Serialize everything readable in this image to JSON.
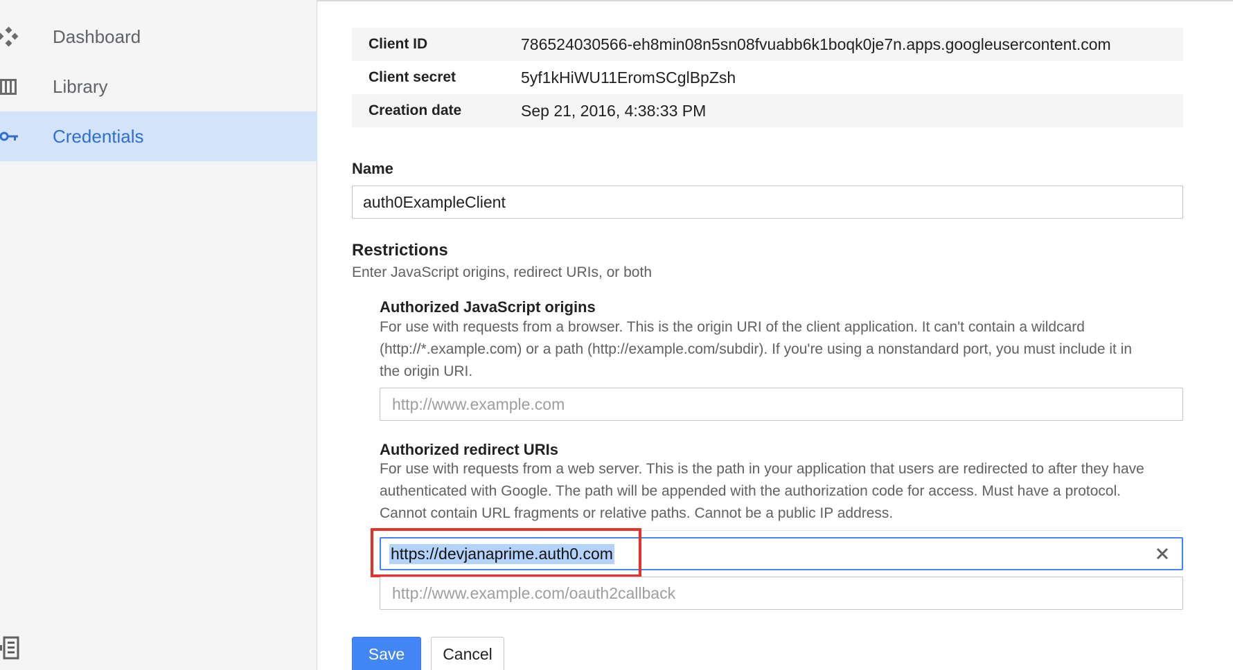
{
  "sidebar": {
    "items": [
      {
        "label": "Dashboard",
        "icon": "dashboard-icon",
        "active": false
      },
      {
        "label": "Library",
        "icon": "library-icon",
        "active": false
      },
      {
        "label": "Credentials",
        "icon": "key-icon",
        "active": true
      }
    ],
    "bottom_icon": "sidebar-toggle-icon"
  },
  "client_info": {
    "rows": [
      {
        "key": "Client ID",
        "value": "786524030566-eh8min08n5sn08fvuabb6k1boqk0je7n.apps.googleusercontent.com"
      },
      {
        "key": "Client secret",
        "value": "5yf1kHiWU11EromSCglBpZsh"
      },
      {
        "key": "Creation date",
        "value": "Sep 21, 2016, 4:38:33 PM"
      }
    ]
  },
  "name_section": {
    "label": "Name",
    "value": "auth0ExampleClient"
  },
  "restrictions": {
    "title": "Restrictions",
    "subtitle": "Enter JavaScript origins, redirect URIs, or both",
    "js_origins": {
      "title": "Authorized JavaScript origins",
      "help_line1": "For use with requests from a browser. This is the origin URI of the client application. It can't contain a wildcard",
      "help_line2": "(http://*.example.com) or a path (http://example.com/subdir). If you're using a nonstandard port, you must include it in",
      "help_line3": "the origin URI.",
      "placeholder": "http://www.example.com"
    },
    "redirect_uris": {
      "title": "Authorized redirect URIs",
      "help_line1": "For use with requests from a web server. This is the path in your application that users are redirected to after they have",
      "help_line2": "authenticated with Google. The path will be appended with the authorization code for access. Must have a protocol.",
      "help_line3": "Cannot contain URL fragments or relative paths. Cannot be a public IP address.",
      "entered_value": "https://devjanaprime.auth0.com",
      "new_placeholder": "http://www.example.com/oauth2callback"
    }
  },
  "actions": {
    "save_label": "Save",
    "cancel_label": "Cancel"
  },
  "colors": {
    "accent": "#4285f4",
    "active_nav_bg": "#d3e3fa",
    "annotation": "#e8312a"
  }
}
